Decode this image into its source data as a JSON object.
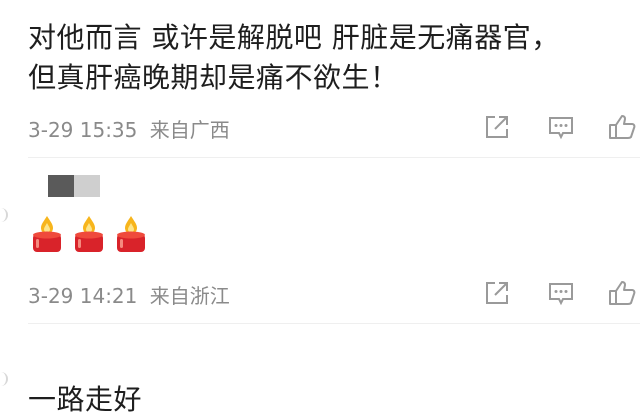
{
  "comments": [
    {
      "lines": [
        "对他而言 或许是解脱吧  肝脏是无痛器官，",
        "但真肝癌晚期却是痛不欲生！"
      ],
      "time": "3-29 15:35",
      "location": "来自广西"
    },
    {
      "emoji": [
        "candle-icon",
        "candle-icon",
        "candle-icon"
      ],
      "time": "3-29 14:21",
      "location": "来自浙江"
    },
    {
      "lines": [
        "一路走好"
      ]
    }
  ],
  "actions": [
    "share-icon",
    "comment-icon",
    "like-icon"
  ],
  "colors": {
    "text": "#1e1e1e",
    "meta": "#8a8a8a",
    "icon": "#9a9a9a",
    "candle_red": "#d9232a",
    "flame": "#f7b51c"
  }
}
